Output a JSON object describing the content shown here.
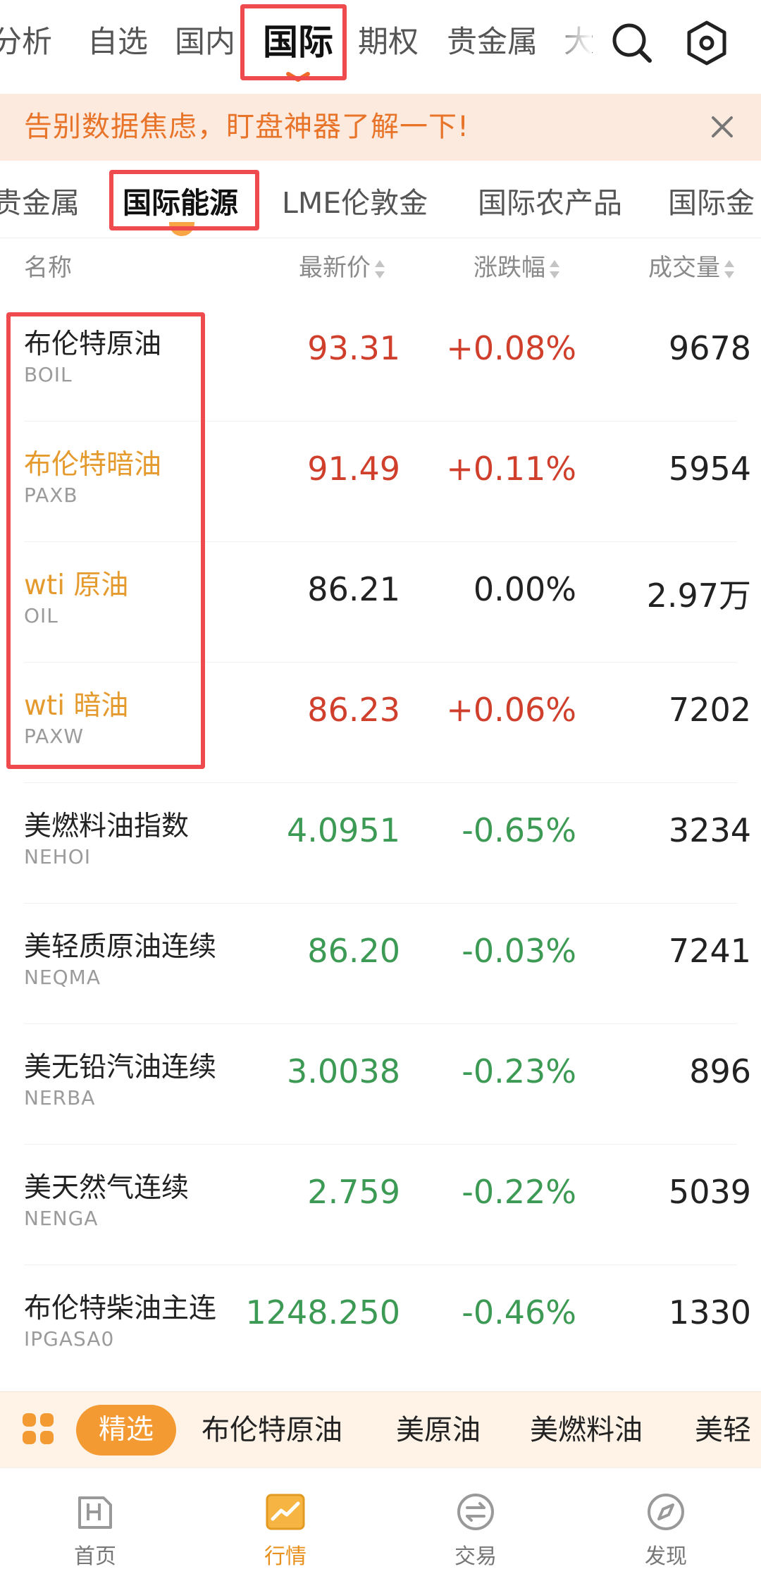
{
  "top_tabs": [
    {
      "label": "分析",
      "key": "analysis"
    },
    {
      "label": "自选",
      "key": "watchlist"
    },
    {
      "label": "国内",
      "key": "domestic"
    },
    {
      "label": "国际",
      "key": "international"
    },
    {
      "label": "期权",
      "key": "options"
    },
    {
      "label": "贵金属",
      "key": "precious"
    },
    {
      "label": "大",
      "key": "more"
    }
  ],
  "top_active": "国际",
  "banner": {
    "text": "告别数据焦虑，盯盘神器了解一下!"
  },
  "sub_tabs": [
    "贵金属",
    "国际能源",
    "LME伦敦金",
    "国际农产品",
    "国际金"
  ],
  "columns": {
    "name": "名称",
    "price": "最新价",
    "change": "涨跌幅",
    "volume": "成交量"
  },
  "rows": [
    {
      "name": "布伦特原油",
      "code": "BOIL",
      "price": "93.31",
      "change": "+0.08%",
      "volume": "9678",
      "trend": "up",
      "name_color": "default"
    },
    {
      "name": "布伦特暗油",
      "code": "PAXB",
      "price": "91.49",
      "change": "+0.11%",
      "volume": "5954",
      "trend": "up",
      "name_color": "orange"
    },
    {
      "name": "wti 原油",
      "code": "OIL",
      "price": "86.21",
      "change": "0.00%",
      "volume": "2.97万",
      "trend": "flat",
      "name_color": "orange"
    },
    {
      "name": "wti 暗油",
      "code": "PAXW",
      "price": "86.23",
      "change": "+0.06%",
      "volume": "7202",
      "trend": "up",
      "name_color": "orange"
    },
    {
      "name": "美燃料油指数",
      "code": "NEHOI",
      "price": "4.0951",
      "change": "-0.65%",
      "volume": "3234",
      "trend": "down",
      "name_color": "default"
    },
    {
      "name": "美轻质原油连续",
      "code": "NEQMA",
      "price": "86.20",
      "change": "-0.03%",
      "volume": "7241",
      "trend": "down",
      "name_color": "default"
    },
    {
      "name": "美无铅汽油连续",
      "code": "NERBA",
      "price": "3.0038",
      "change": "-0.23%",
      "volume": "896",
      "trend": "down",
      "name_color": "default"
    },
    {
      "name": "美天然气连续",
      "code": "NENGA",
      "price": "2.759",
      "change": "-0.22%",
      "volume": "5039",
      "trend": "down",
      "name_color": "default"
    },
    {
      "name": "布伦特柴油主连",
      "code": "IPGASA0",
      "price": "1248.250",
      "change": "-0.46%",
      "volume": "1330",
      "trend": "down",
      "name_color": "default"
    }
  ],
  "quick_bar": {
    "pill": "精选",
    "items": [
      "布伦特原油",
      "美原油",
      "美燃料油",
      "美轻"
    ]
  },
  "bottom_nav": [
    {
      "label": "首页",
      "icon": "home-h-icon"
    },
    {
      "label": "行情",
      "icon": "market-chart-icon"
    },
    {
      "label": "交易",
      "icon": "trade-exchange-icon"
    },
    {
      "label": "发现",
      "icon": "compass-icon"
    }
  ],
  "colors": {
    "accent": "#f39a33",
    "up": "#cf3f2c",
    "down": "#3c9a55",
    "highlight_box": "#ef4b4f",
    "banner_bg": "#fdeade",
    "banner_text": "#e8742a"
  }
}
